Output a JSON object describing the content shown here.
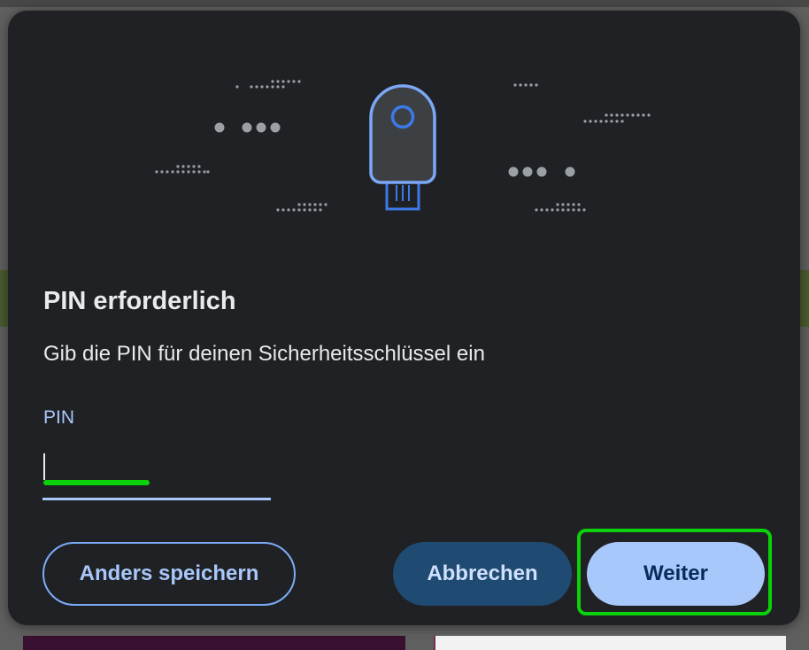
{
  "dialog": {
    "title": "PIN erforderlich",
    "description": "Gib die PIN für deinen Sicherheitsschlüssel ein",
    "pin_field": {
      "label": "PIN",
      "value": "",
      "placeholder": ""
    },
    "buttons": {
      "save_other": "Anders speichern",
      "cancel": "Abbrechen",
      "next": "Weiter"
    },
    "illustration_icon": "usb-security-key-icon"
  },
  "colors": {
    "dialog_bg": "#202124",
    "accent": "#a8c7fa",
    "cancel_bg": "#1f4a72",
    "highlight": "#0ad10a"
  }
}
